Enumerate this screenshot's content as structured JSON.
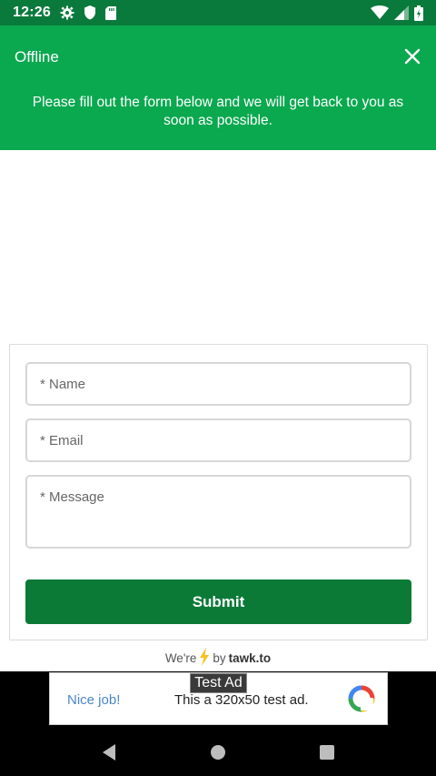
{
  "status_bar": {
    "time": "12:26"
  },
  "header": {
    "title": "Offline",
    "message": "Please fill out the form below and we will get back to you as soon as possible."
  },
  "form": {
    "name_placeholder": "* Name",
    "email_placeholder": "* Email",
    "message_placeholder": "* Message",
    "submit_label": "Submit"
  },
  "footer": {
    "powered_prefix": "We're",
    "powered_by": "by",
    "brand": "tawk.to"
  },
  "ad": {
    "label": "Test Ad",
    "nice": "Nice job!",
    "text": "This a 320x50 test ad."
  },
  "colors": {
    "status_bar": "#0a7a3c",
    "header": "#0aa84f",
    "submit": "#0b7a37"
  }
}
